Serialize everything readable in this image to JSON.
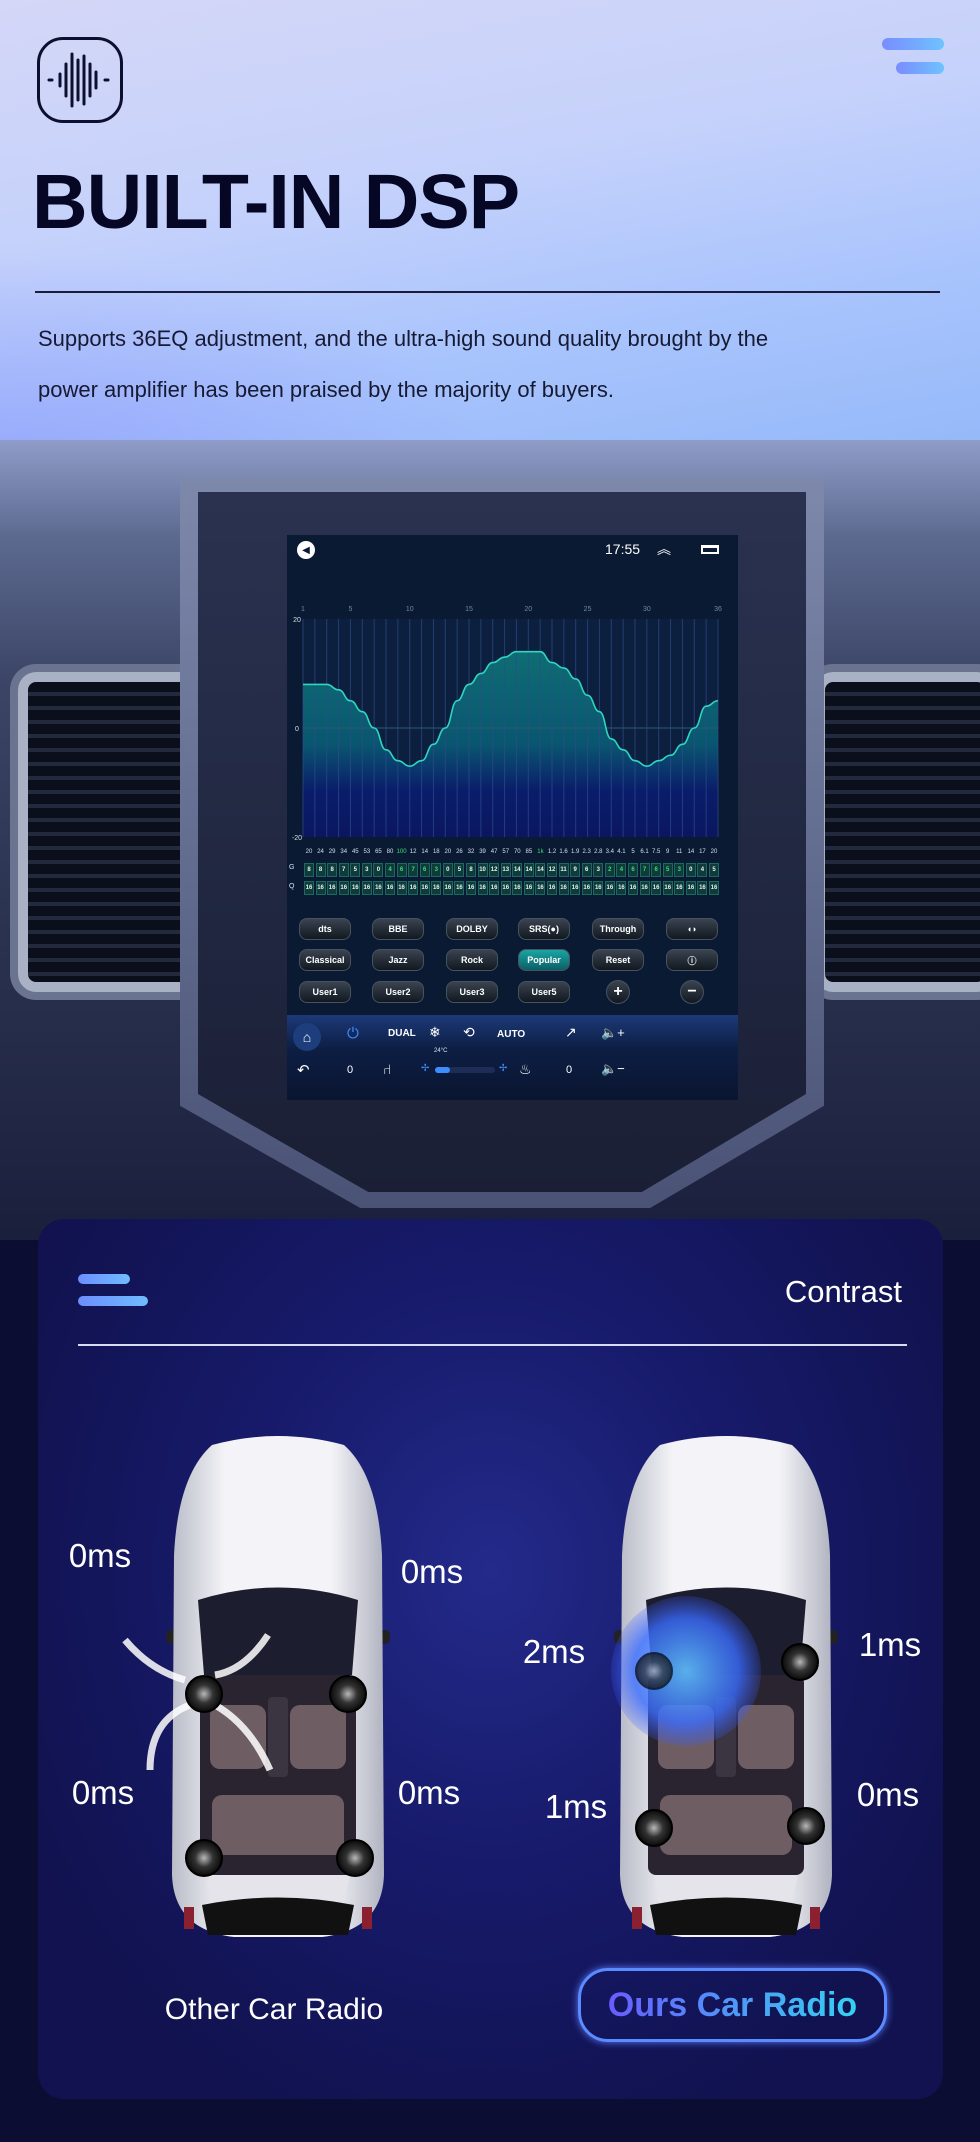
{
  "header": {
    "logo_icon": "sound-wave-icon",
    "menu_icon": "menu-icon",
    "title": "BUILT-IN DSP",
    "description": [
      "Supports 36EQ adjustment, and the ultra-high sound quality brought by the",
      "power amplifier has been praised by the majority of buyers."
    ]
  },
  "screen": {
    "status": {
      "time": "17:55",
      "back_icon": "back-circle-icon",
      "expand_icon": "double-chevron-up-icon",
      "window_icon": "recent-apps-icon"
    },
    "eq": {
      "band_axis": [
        "1",
        "5",
        "10",
        "15",
        "20",
        "25",
        "30",
        "36"
      ],
      "y_ticks": [
        "20",
        "0",
        "-20"
      ],
      "ylim": [
        -20,
        20
      ],
      "frequencies": [
        "20",
        "24",
        "29",
        "34",
        "45",
        "53",
        "65",
        "80",
        "100",
        "12",
        "14",
        "18",
        "20",
        "26",
        "32",
        "39",
        "47",
        "57",
        "70",
        "85",
        "1k",
        "1.2",
        "1.6",
        "1.9",
        "2.3",
        "2.8",
        "3.4",
        "4.1",
        "5",
        "6.1",
        "7.5",
        "9",
        "11",
        "14",
        "17",
        "20"
      ],
      "highlighted_frequencies": [
        "100",
        "1k"
      ],
      "g_label": "G",
      "q_label": "Q",
      "gains": [
        8,
        8,
        8,
        7,
        5,
        3,
        0,
        -4,
        -6,
        -7,
        -6,
        -3,
        0,
        5,
        8,
        10,
        12,
        13,
        14,
        14,
        14,
        12,
        11,
        9,
        6,
        3,
        -2,
        -4,
        -6,
        -7,
        -6,
        -5,
        -3,
        0,
        4,
        5
      ],
      "q": [
        16,
        16,
        16,
        16,
        16,
        16,
        16,
        16,
        16,
        16,
        16,
        16,
        16,
        16,
        16,
        16,
        16,
        16,
        16,
        16,
        16,
        16,
        16,
        16,
        16,
        16,
        16,
        16,
        16,
        16,
        16,
        16,
        16,
        16,
        16,
        16
      ],
      "curve_color": "#2fd6c0"
    },
    "buttons": [
      [
        {
          "label": "dts"
        },
        {
          "label": "BBE"
        },
        {
          "label": "DOLBY"
        },
        {
          "label": "SRS(●)"
        },
        {
          "label": "Through"
        },
        {
          "label": "◖◗",
          "icon": "speaker-balance-icon"
        }
      ],
      [
        {
          "label": "Classical"
        },
        {
          "label": "Jazz"
        },
        {
          "label": "Rock"
        },
        {
          "label": "Popular",
          "active": true
        },
        {
          "label": "Reset"
        },
        {
          "label": "ⓘ",
          "icon": "info-icon"
        }
      ],
      [
        {
          "label": "User1"
        },
        {
          "label": "User2"
        },
        {
          "label": "User3"
        },
        {
          "label": "User5"
        },
        {
          "label": "+",
          "icon": "plus-icon"
        },
        {
          "label": "−",
          "icon": "minus-icon"
        }
      ]
    ],
    "climate": {
      "dual": "DUAL",
      "auto": "AUTO",
      "temp": "24°C",
      "left_value": "0",
      "right_value": "0",
      "fan_level": 0.25,
      "icons": [
        "home-icon",
        "power-icon",
        "snowflake-icon",
        "recirculation-icon",
        "airflow-icon",
        "volume-up-icon",
        "back-arrow-icon",
        "seat-icon",
        "fan-icon",
        "seat-heat-icon",
        "volume-down-icon"
      ]
    }
  },
  "contrast": {
    "menu_icon": "menu-icon",
    "title": "Contrast",
    "other": {
      "label": "Other Car Radio",
      "delays": [
        "0ms",
        "0ms",
        "0ms",
        "0ms"
      ]
    },
    "ours": {
      "label": "Ours Car Radio",
      "delays": [
        "2ms",
        "1ms",
        "1ms",
        "0ms"
      ]
    },
    "accent": "#5a8cff"
  }
}
